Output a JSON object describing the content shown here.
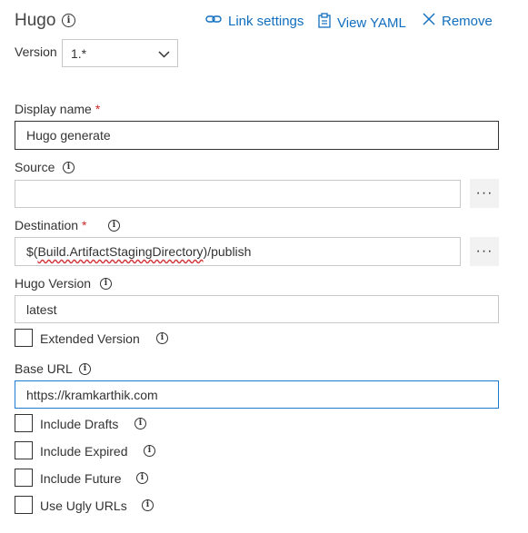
{
  "header": {
    "title": "Hugo",
    "link_settings": "Link settings",
    "view_yaml": "View YAML",
    "remove": "Remove"
  },
  "version": {
    "label": "Version",
    "value": "1.*"
  },
  "display_name": {
    "label": "Display name",
    "required": "*",
    "value": "Hugo generate"
  },
  "source": {
    "label": "Source",
    "value": ""
  },
  "destination": {
    "label": "Destination",
    "required": "*",
    "value_prefix": "$(",
    "value_var": "Build.ArtifactStagingDirectory",
    "value_suffix": ")/publish"
  },
  "hugo_version": {
    "label": "Hugo Version",
    "value": "latest"
  },
  "extended_version": {
    "label": "Extended Version",
    "checked": false
  },
  "base_url": {
    "label": "Base URL",
    "value": "https://kramkarthik.com"
  },
  "options": [
    {
      "label": "Include Drafts",
      "checked": false
    },
    {
      "label": "Include Expired",
      "checked": false
    },
    {
      "label": "Include Future",
      "checked": false
    },
    {
      "label": "Use Ugly URLs",
      "checked": false
    }
  ],
  "ellipsis": "···",
  "colors": {
    "accent": "#106ebe",
    "required": "#c82828",
    "focus_border": "#1f7ad4"
  }
}
